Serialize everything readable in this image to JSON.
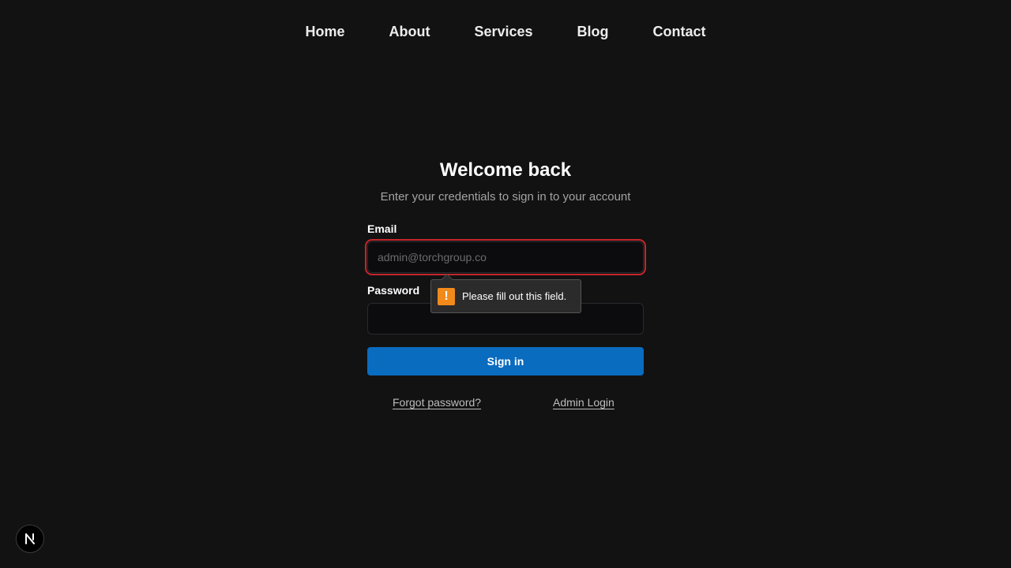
{
  "nav": {
    "items": [
      {
        "label": "Home"
      },
      {
        "label": "About"
      },
      {
        "label": "Services"
      },
      {
        "label": "Blog"
      },
      {
        "label": "Contact"
      }
    ]
  },
  "login": {
    "title": "Welcome back",
    "subtitle": "Enter your credentials to sign in to your account",
    "email_label": "Email",
    "email_placeholder": "admin@torchgroup.co",
    "email_value": "",
    "password_label": "Password",
    "password_value": "",
    "signin_label": "Sign in",
    "forgot_label": "Forgot password?",
    "admin_label": "Admin Login"
  },
  "validation": {
    "message": "Please fill out this field.",
    "icon": "warning-icon",
    "icon_color": "#f18a1a"
  },
  "colors": {
    "background": "#121213",
    "primary_button": "#0a6cbf",
    "error_outline": "#c4262b"
  },
  "badge": {
    "icon": "nextjs-logo-icon"
  }
}
